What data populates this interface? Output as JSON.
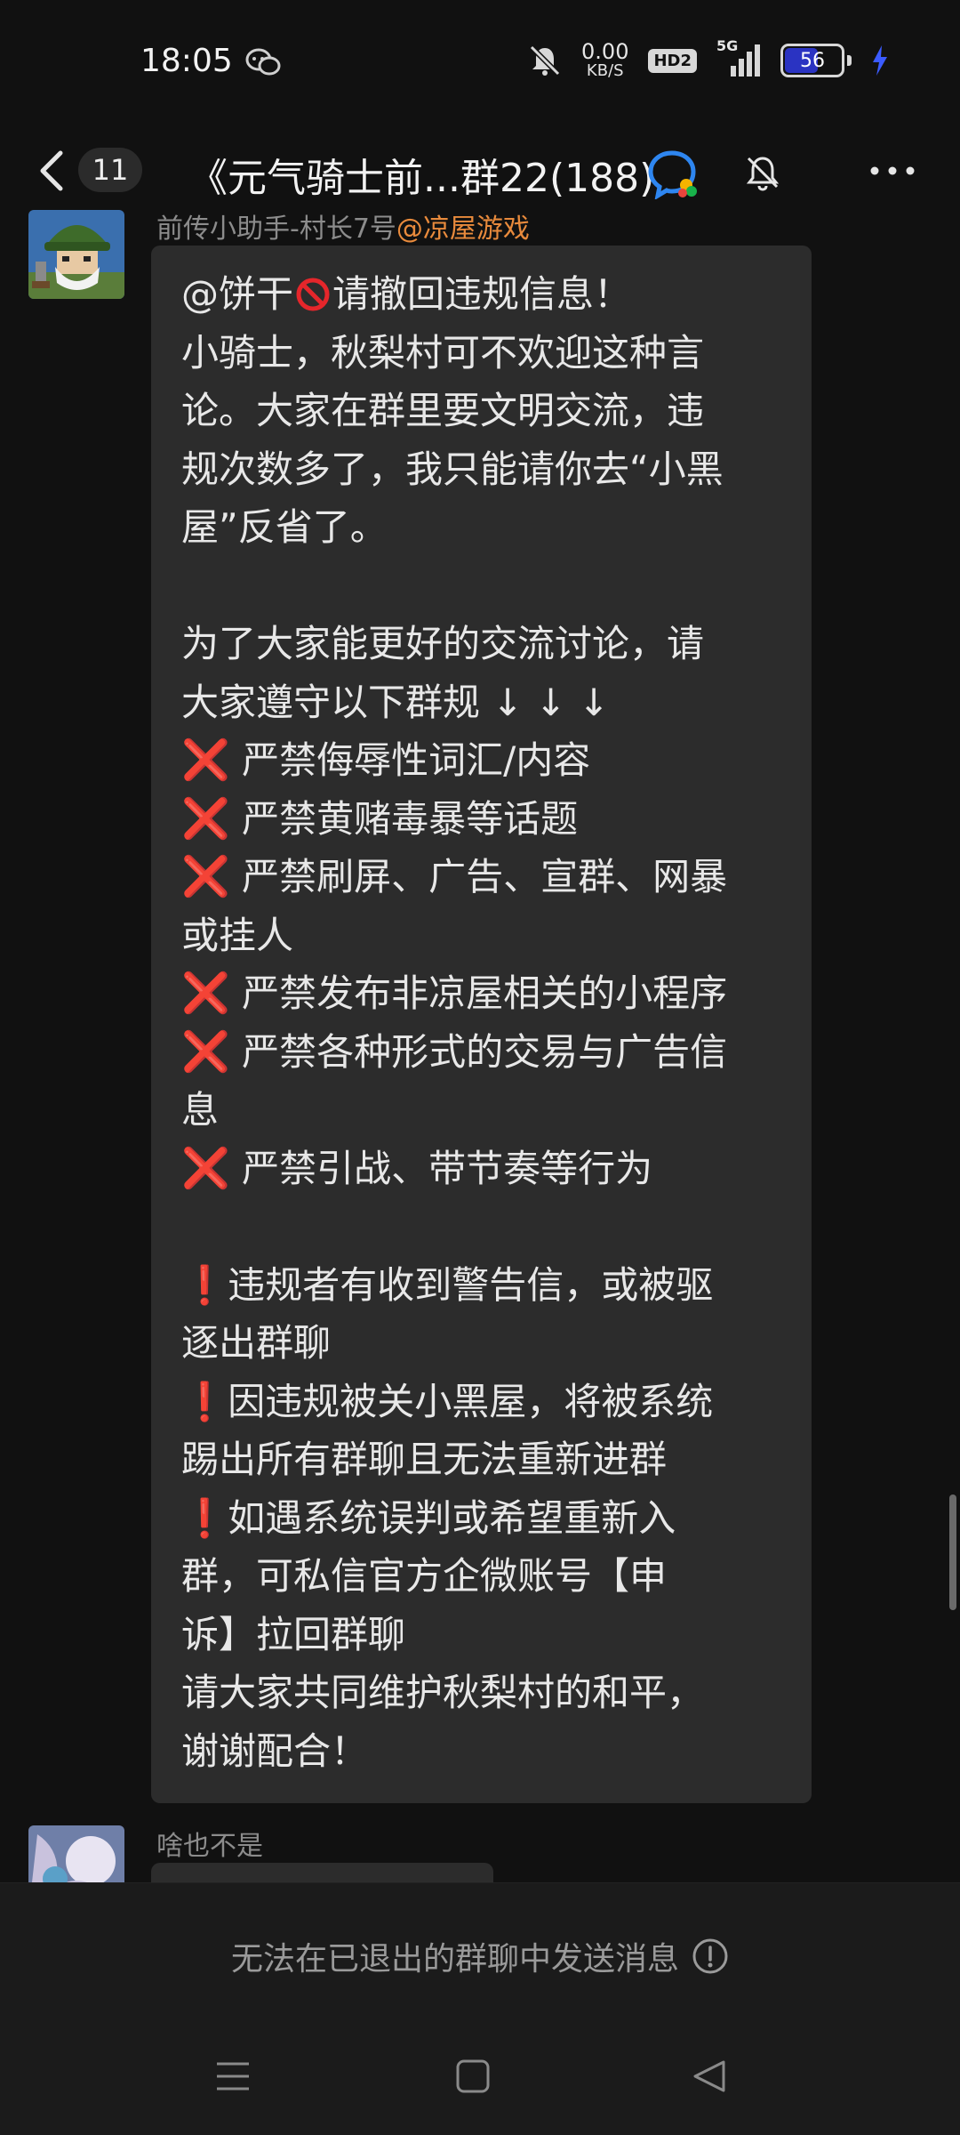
{
  "status_bar": {
    "time": "18:05",
    "net_speed_value": "0.00",
    "net_speed_unit": "KB/S",
    "hd_label": "HD2",
    "network_label": "5G",
    "battery_level": "56",
    "battery_fraction": 0.56
  },
  "header": {
    "unread_count": "11",
    "title": "《元气骑士前...群22(188)"
  },
  "messages": [
    {
      "sender_name": "前传小助手-村长7号",
      "sender_tag": "@凉屋游戏",
      "lines": [
        {
          "pre": "@饼干",
          "post": "请撤回违规信息！"
        },
        {
          "text": "小骑士，秋梨村可不欢迎这种言"
        },
        {
          "text": "论。大家在群里要文明交流，违"
        },
        {
          "text": "规次数多了，我只能请你去“小黑"
        },
        {
          "text": "屋”反省了。"
        },
        {
          "text": ""
        },
        {
          "text": "为了大家能更好的交流讨论，请"
        },
        {
          "text": "大家遵守以下群规 ↓ ↓ ↓"
        },
        {
          "mark": "❌",
          "text": " 严禁侮辱性词汇/内容"
        },
        {
          "mark": "❌",
          "text": " 严禁黄赌毒暴等话题"
        },
        {
          "mark": "❌",
          "text": " 严禁刷屏、广告、宣群、网暴"
        },
        {
          "text": "或挂人"
        },
        {
          "mark": "❌",
          "text": " 严禁发布非凉屋相关的小程序"
        },
        {
          "mark": "❌",
          "text": " 严禁各种形式的交易与广告信"
        },
        {
          "text": "息"
        },
        {
          "mark": "❌",
          "text": " 严禁引战、带节奏等行为"
        },
        {
          "text": ""
        },
        {
          "excl": "❗",
          "text": "违规者有收到警告信，或被驱"
        },
        {
          "text": "逐出群聊"
        },
        {
          "excl": "❗",
          "text": "因违规被关小黑屋，将被系统"
        },
        {
          "text": "踢出所有群聊且无法重新进群"
        },
        {
          "excl": "❗",
          "text": "如遇系统误判或希望重新入"
        },
        {
          "text": "群，可私信官方企微账号【申"
        },
        {
          "text": "诉】拉回群聊"
        },
        {
          "text": "请大家共同维护秋梨村的和平，"
        },
        {
          "text": "谢谢配合！"
        }
      ]
    },
    {
      "sender_name": "啥也不是"
    }
  ],
  "footer": {
    "notice": "无法在已退出的群聊中发送消息"
  },
  "colors": {
    "background": "#111111",
    "bubble": "#2c2c2c",
    "sender_tag": "#e88a3c",
    "cross_mark": "#e5262b",
    "battery_fill": "#2a33c2"
  },
  "icons": {
    "back": "chevron-left-icon",
    "group": "group-chat-icon",
    "mute": "bell-off-icon",
    "more": "more-horizontal-icon",
    "info": "info-circle-icon",
    "nav_menu": "menu-icon",
    "nav_home": "square-home-icon",
    "nav_back": "triangle-back-icon"
  }
}
